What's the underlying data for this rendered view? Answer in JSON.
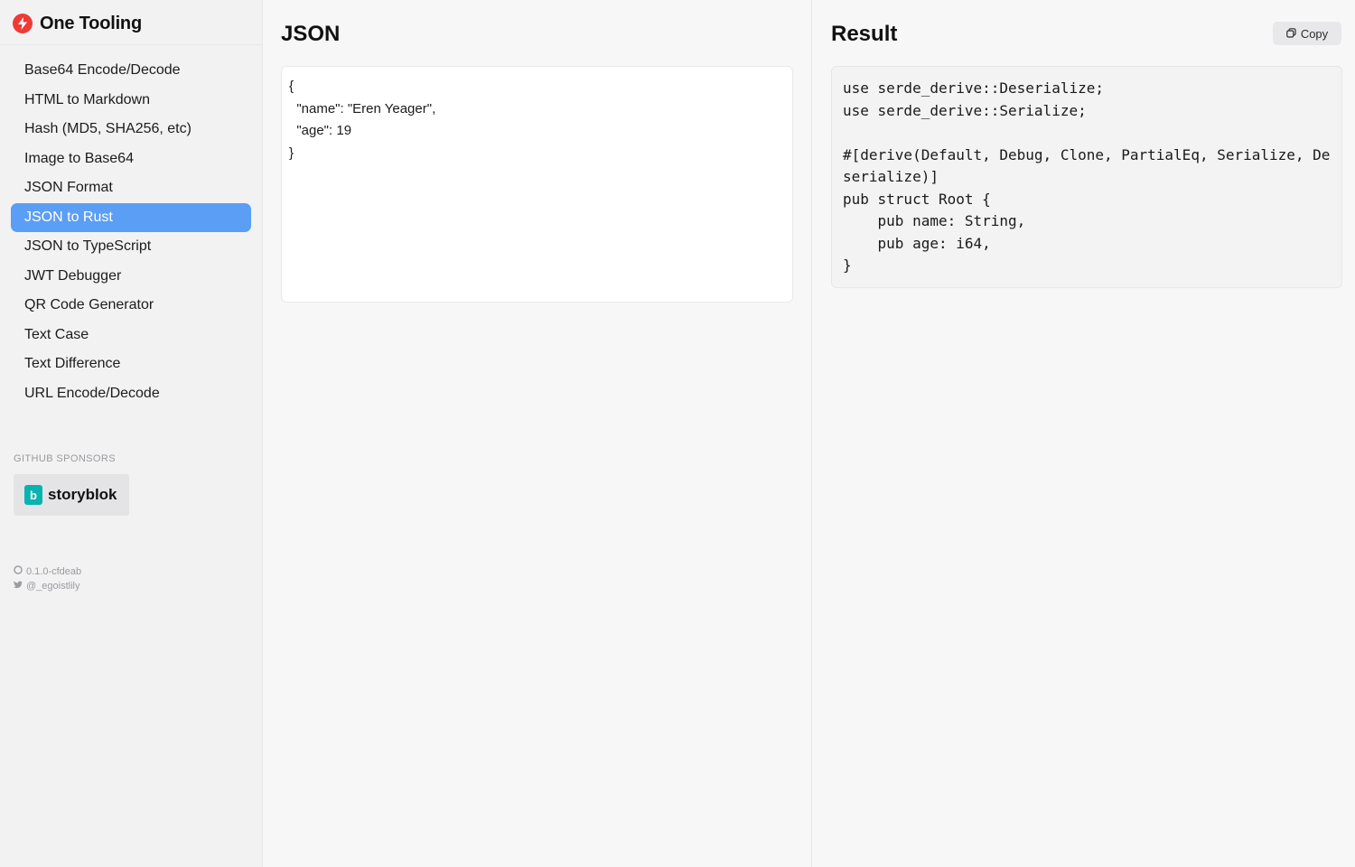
{
  "app": {
    "name": "One Tooling",
    "accent": "#5b9ef5",
    "logo_color": "#f03a35"
  },
  "sidebar": {
    "items": [
      {
        "label": "Base64 Encode/Decode",
        "active": false
      },
      {
        "label": "HTML to Markdown",
        "active": false
      },
      {
        "label": "Hash (MD5, SHA256, etc)",
        "active": false
      },
      {
        "label": "Image to Base64",
        "active": false
      },
      {
        "label": "JSON Format",
        "active": false
      },
      {
        "label": "JSON to Rust",
        "active": true
      },
      {
        "label": "JSON to TypeScript",
        "active": false
      },
      {
        "label": "JWT Debugger",
        "active": false
      },
      {
        "label": "QR Code Generator",
        "active": false
      },
      {
        "label": "Text Case",
        "active": false
      },
      {
        "label": "Text Difference",
        "active": false
      },
      {
        "label": "URL Encode/Decode",
        "active": false
      }
    ],
    "sponsors_label": "GITHUB SPONSORS",
    "sponsor": {
      "name": "storyblok",
      "icon": "storyblok-logo",
      "color": "#09b3af"
    },
    "version": "0.1.0-cfdeab",
    "twitter": "@_egoistlily"
  },
  "json_pane": {
    "title": "JSON",
    "input": "{\n  \"name\": \"Eren Yeager\",\n  \"age\": 19\n}"
  },
  "result_pane": {
    "title": "Result",
    "copy_label": "Copy",
    "output": "use serde_derive::Deserialize;\nuse serde_derive::Serialize;\n\n#[derive(Default, Debug, Clone, PartialEq, Serialize, Deserialize)]\npub struct Root {\n    pub name: String,\n    pub age: i64,\n}"
  }
}
